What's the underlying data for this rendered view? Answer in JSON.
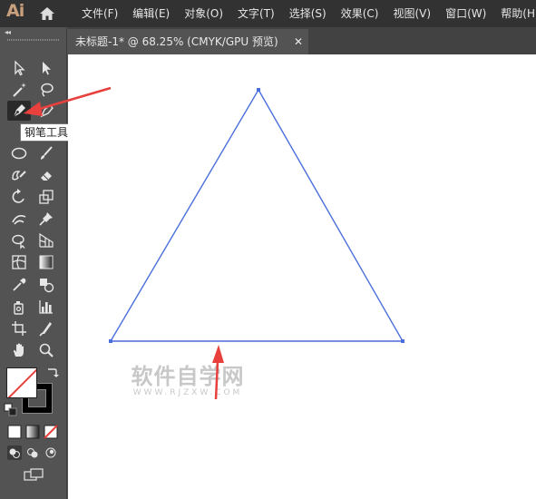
{
  "app": {
    "logo_text": "Ai"
  },
  "menubar": {
    "items": [
      "文件(F)",
      "编辑(E)",
      "对象(O)",
      "文字(T)",
      "选择(S)",
      "效果(C)",
      "视图(V)",
      "窗口(W)",
      "帮助(H)"
    ]
  },
  "document": {
    "tab_label": "未标题-1* @ 68.25% (CMYK/GPU 预览)",
    "close_glyph": "✕"
  },
  "toolbar": {
    "collapse_glyph": "◂◂",
    "tooltip": "钢笔工具 (P)",
    "selected_tool": "pen-tool"
  },
  "watermark": {
    "main": "软件自学网",
    "sub": "WWW.RJZXW.COM"
  },
  "colors": {
    "menubar_bg": "#323232",
    "panel_bg": "#535353",
    "canvas_bg": "#ffffff",
    "path_stroke": "#4a6fdc",
    "annotation_red": "#e8403c"
  }
}
